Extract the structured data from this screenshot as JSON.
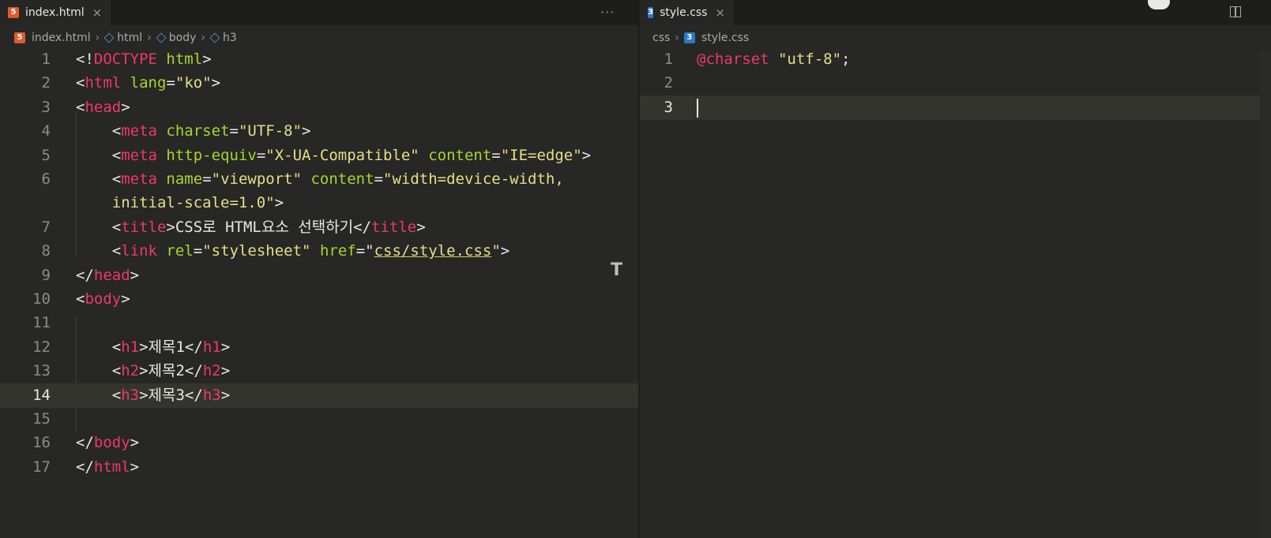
{
  "left": {
    "tab_label": "index.html",
    "tab_close": "×",
    "more": "···",
    "file_icon": "5",
    "breadcrumb": [
      "index.html",
      "html",
      "body",
      "h3"
    ],
    "lines": [
      {
        "n": "1",
        "seg": [
          [
            "plain",
            "<!"
          ],
          [
            "tag",
            "DOCTYPE"
          ],
          [
            "plain",
            " "
          ],
          [
            "attr",
            "html"
          ],
          [
            "plain",
            ">"
          ]
        ]
      },
      {
        "n": "2",
        "seg": [
          [
            "plain",
            "<"
          ],
          [
            "tag",
            "html"
          ],
          [
            "plain",
            " "
          ],
          [
            "attr",
            "lang"
          ],
          [
            "plain",
            "="
          ],
          [
            "str",
            "\"ko\""
          ],
          [
            "plain",
            ">"
          ]
        ]
      },
      {
        "n": "3",
        "seg": [
          [
            "plain",
            "<"
          ],
          [
            "tag",
            "head"
          ],
          [
            "plain",
            ">"
          ]
        ]
      },
      {
        "n": "4",
        "seg": [
          [
            "plain",
            "    <"
          ],
          [
            "tag",
            "meta"
          ],
          [
            "plain",
            " "
          ],
          [
            "attr",
            "charset"
          ],
          [
            "plain",
            "="
          ],
          [
            "str",
            "\"UTF-8\""
          ],
          [
            "plain",
            ">"
          ]
        ]
      },
      {
        "n": "5",
        "seg": [
          [
            "plain",
            "    <"
          ],
          [
            "tag",
            "meta"
          ],
          [
            "plain",
            " "
          ],
          [
            "attr",
            "http-equiv"
          ],
          [
            "plain",
            "="
          ],
          [
            "str",
            "\"X-UA-Compatible\""
          ],
          [
            "plain",
            " "
          ],
          [
            "attr",
            "content"
          ],
          [
            "plain",
            "="
          ],
          [
            "str",
            "\"IE=edge\""
          ],
          [
            "plain",
            ">"
          ]
        ]
      },
      {
        "n": "6",
        "seg": [
          [
            "plain",
            "    <"
          ],
          [
            "tag",
            "meta"
          ],
          [
            "plain",
            " "
          ],
          [
            "attr",
            "name"
          ],
          [
            "plain",
            "="
          ],
          [
            "str",
            "\"viewport\""
          ],
          [
            "plain",
            " "
          ],
          [
            "attr",
            "content"
          ],
          [
            "plain",
            "="
          ],
          [
            "str",
            "\"width=device-width,"
          ]
        ]
      },
      {
        "n": "",
        "seg": [
          [
            "str",
            "    initial-scale=1.0\""
          ],
          [
            "plain",
            ">"
          ]
        ]
      },
      {
        "n": "7",
        "seg": [
          [
            "plain",
            "    <"
          ],
          [
            "tag",
            "title"
          ],
          [
            "plain",
            ">CSS로 HTML요소 선택하기</"
          ],
          [
            "tag",
            "title"
          ],
          [
            "plain",
            ">"
          ]
        ]
      },
      {
        "n": "8",
        "seg": [
          [
            "plain",
            "    <"
          ],
          [
            "tag",
            "link"
          ],
          [
            "plain",
            " "
          ],
          [
            "attr",
            "rel"
          ],
          [
            "plain",
            "="
          ],
          [
            "str",
            "\"stylesheet\""
          ],
          [
            "plain",
            " "
          ],
          [
            "attr",
            "href"
          ],
          [
            "plain",
            "=\""
          ],
          [
            "str link",
            "css/style.css"
          ],
          [
            "str",
            "\""
          ],
          [
            "plain",
            ">"
          ]
        ]
      },
      {
        "n": "9",
        "seg": [
          [
            "plain",
            "</"
          ],
          [
            "tag",
            "head"
          ],
          [
            "plain",
            ">"
          ]
        ]
      },
      {
        "n": "10",
        "seg": [
          [
            "plain",
            "<"
          ],
          [
            "tag",
            "body"
          ],
          [
            "plain",
            ">"
          ]
        ]
      },
      {
        "n": "11",
        "seg": []
      },
      {
        "n": "12",
        "seg": [
          [
            "plain",
            "    <"
          ],
          [
            "tag",
            "h1"
          ],
          [
            "plain",
            ">제목1</"
          ],
          [
            "tag",
            "h1"
          ],
          [
            "plain",
            ">"
          ]
        ]
      },
      {
        "n": "13",
        "seg": [
          [
            "plain",
            "    <"
          ],
          [
            "tag",
            "h2"
          ],
          [
            "plain",
            ">제목2</"
          ],
          [
            "tag",
            "h2"
          ],
          [
            "plain",
            ">"
          ]
        ]
      },
      {
        "n": "14",
        "seg": [
          [
            "plain",
            "    <"
          ],
          [
            "tag",
            "h3"
          ],
          [
            "plain",
            ">제목3</"
          ],
          [
            "tag",
            "h3"
          ],
          [
            "plain",
            ">"
          ]
        ],
        "current": true
      },
      {
        "n": "15",
        "seg": []
      },
      {
        "n": "16",
        "seg": [
          [
            "plain",
            "</"
          ],
          [
            "tag",
            "body"
          ],
          [
            "plain",
            ">"
          ]
        ]
      },
      {
        "n": "17",
        "seg": [
          [
            "plain",
            "</"
          ],
          [
            "tag",
            "html"
          ],
          [
            "plain",
            ">"
          ]
        ]
      }
    ]
  },
  "right": {
    "tab_label": "style.css",
    "tab_close": "×",
    "file_icon": "3",
    "breadcrumb": [
      "css",
      "style.css"
    ],
    "lines": [
      {
        "n": "1",
        "seg": [
          [
            "tag",
            "@charset"
          ],
          [
            "plain",
            " "
          ],
          [
            "str",
            "\"utf-8\""
          ],
          [
            "plain",
            ";"
          ]
        ]
      },
      {
        "n": "2",
        "seg": []
      },
      {
        "n": "3",
        "seg": [],
        "current": true
      }
    ]
  },
  "minimap_mark": "T"
}
